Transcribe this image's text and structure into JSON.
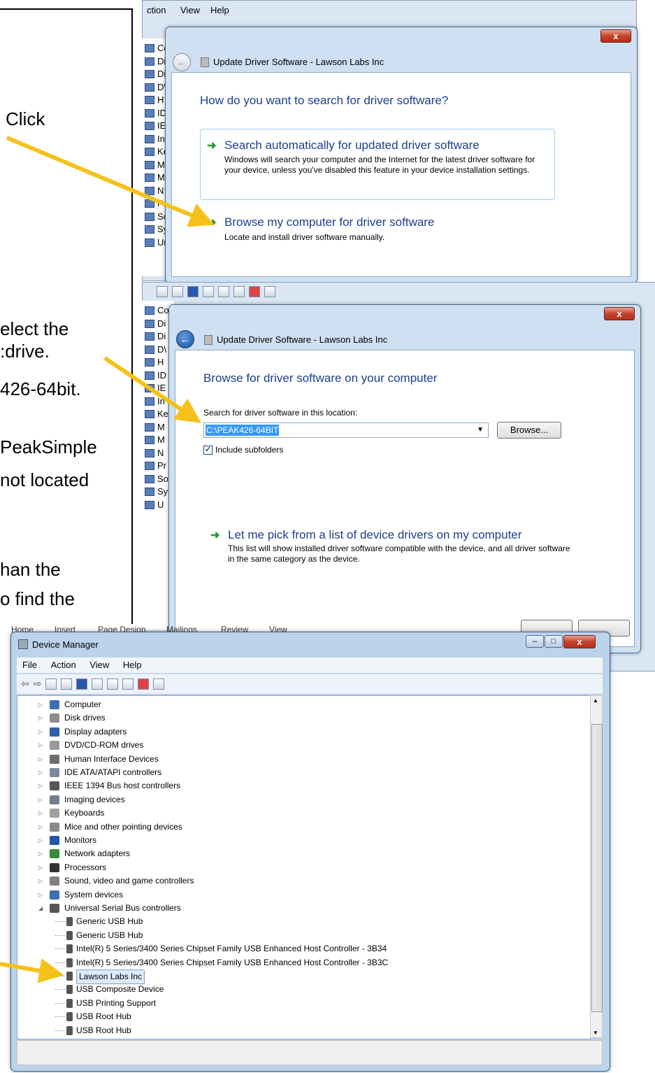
{
  "instructions": {
    "click": "Click",
    "select_line1": "elect the",
    "select_line2": ":drive.",
    "select_line3": "426-64bit.",
    "peak_line1": "PeakSimple",
    "peak_line2": "not located",
    "than_line": "han the",
    "find_line": "o find the"
  },
  "background_window_top": {
    "menu": [
      "ction",
      "View",
      "Help"
    ],
    "strip_letters": [
      "Co",
      "Di",
      "Di",
      "D\\",
      "H",
      "ID",
      "IE",
      "In",
      "Ke",
      "M",
      "M",
      "N",
      "Pr",
      "So",
      "Sy",
      "Ur"
    ]
  },
  "background_window_mid": {
    "strip_letters": [
      "Co",
      "Di",
      "Di",
      "D\\",
      "H",
      "ID",
      "IE",
      "In",
      "Ke",
      "M",
      "M",
      "N",
      "Pr",
      "So",
      "Sy",
      "U"
    ]
  },
  "dialog1": {
    "title": "Update Driver Software - Lawson Labs Inc",
    "heading": "How do you want to search for driver software?",
    "option1_title": "Search automatically for updated driver software",
    "option1_desc": "Windows will search your computer and the Internet for the latest driver software for your device, unless you've disabled this feature in your device installation settings.",
    "option2_title": "Browse my computer for driver software",
    "option2_desc": "Locate and install driver software manually.",
    "close": "x"
  },
  "dialog2": {
    "title": "Update Driver Software - Lawson Labs Inc",
    "heading": "Browse for driver software on your computer",
    "search_label": "Search for driver software in this location:",
    "path_value": "C:\\PEAK426-64BIT",
    "browse_button": "Browse...",
    "include_subfolders": "Include subfolders",
    "include_checked": true,
    "option_title": "Let me pick from a list of device drivers on my computer",
    "option_desc": "This list will show installed driver software compatible with the device, and all driver software in the same category as the device.",
    "close": "x"
  },
  "word_ribbon": [
    "Home",
    "Insert",
    "Page Design",
    "Mailings",
    "Review",
    "View"
  ],
  "device_manager": {
    "title": "Device Manager",
    "menu": [
      "File",
      "Action",
      "View",
      "Help"
    ],
    "categories": [
      {
        "label": "Computer",
        "color": "#3d6fb5"
      },
      {
        "label": "Disk drives",
        "color": "#8c8c8c"
      },
      {
        "label": "Display adapters",
        "color": "#2f5fae"
      },
      {
        "label": "DVD/CD-ROM drives",
        "color": "#9a9a9a"
      },
      {
        "label": "Human Interface Devices",
        "color": "#6d6d6d"
      },
      {
        "label": "IDE ATA/ATAPI controllers",
        "color": "#7b8b9b"
      },
      {
        "label": "IEEE 1394 Bus host controllers",
        "color": "#555555"
      },
      {
        "label": "Imaging devices",
        "color": "#6f7f8f"
      },
      {
        "label": "Keyboards",
        "color": "#a0a0a0"
      },
      {
        "label": "Mice and other pointing devices",
        "color": "#8a8a8a"
      },
      {
        "label": "Monitors",
        "color": "#2456a8"
      },
      {
        "label": "Network adapters",
        "color": "#3a8a3a"
      },
      {
        "label": "Processors",
        "color": "#333333"
      },
      {
        "label": "Sound, video and game controllers",
        "color": "#808080"
      },
      {
        "label": "System devices",
        "color": "#3d6fb5"
      },
      {
        "label": "Universal Serial Bus controllers",
        "color": "#555555"
      }
    ],
    "usb_children": [
      "Generic USB Hub",
      "Generic USB Hub",
      "Intel(R) 5 Series/3400 Series Chipset Family USB Enhanced Host Controller - 3B34",
      "Intel(R) 5 Series/3400 Series Chipset Family USB Enhanced Host Controller - 3B3C",
      "Lawson Labs Inc",
      "USB Composite Device",
      "USB Printing Support",
      "USB Root Hub",
      "USB Root Hub"
    ],
    "selected_child": "Lawson Labs Inc"
  },
  "colors": {
    "arrow": "#f5c21b",
    "link_blue": "#1b3f8c",
    "green_arrow": "#1d9c24",
    "selection_blue": "#3399ff"
  }
}
